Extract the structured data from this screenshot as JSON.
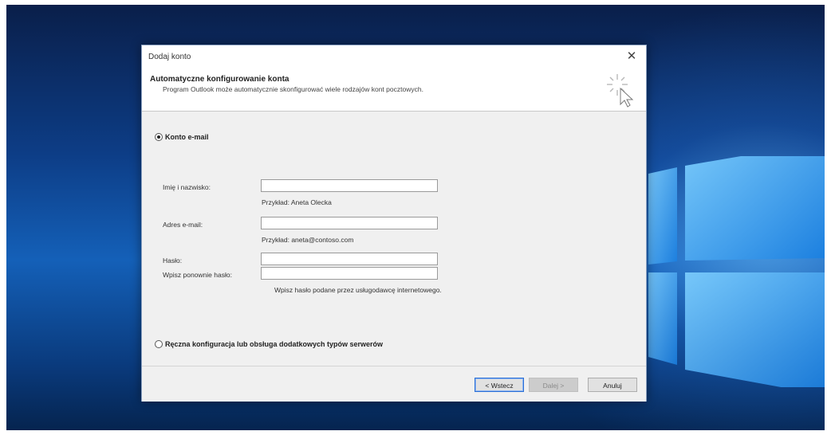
{
  "dialog": {
    "title": "Dodaj konto",
    "close_symbol": "✕",
    "header_title": "Automatyczne konfigurowanie konta",
    "header_subtitle": "Program Outlook może automatycznie skonfigurować wiele rodzajów kont pocztowych.",
    "header_icon": "wizard-cursor-sparkle-icon"
  },
  "options": {
    "email_account": {
      "label": "Konto e-mail",
      "selected": true
    },
    "manual_config": {
      "label": "Ręczna konfiguracja lub obsługa dodatkowych typów serwerów",
      "selected": false
    }
  },
  "form": {
    "name": {
      "label": "Imię i nazwisko:",
      "value": "",
      "hint": "Przykład: Aneta Olecka"
    },
    "email": {
      "label": "Adres e-mail:",
      "value": "",
      "hint": "Przykład: aneta@contoso.com"
    },
    "password": {
      "label": "Hasło:",
      "value": ""
    },
    "password_repeat": {
      "label": "Wpisz ponownie hasło:",
      "value": "",
      "hint": "Wpisz hasło podane przez usługodawcę internetowego."
    }
  },
  "buttons": {
    "back": "< Wstecz",
    "next": "Dalej >",
    "cancel": "Anuluj"
  },
  "desktop": {
    "background_color": "#0d3d86",
    "logo": "windows-logo-icon"
  }
}
